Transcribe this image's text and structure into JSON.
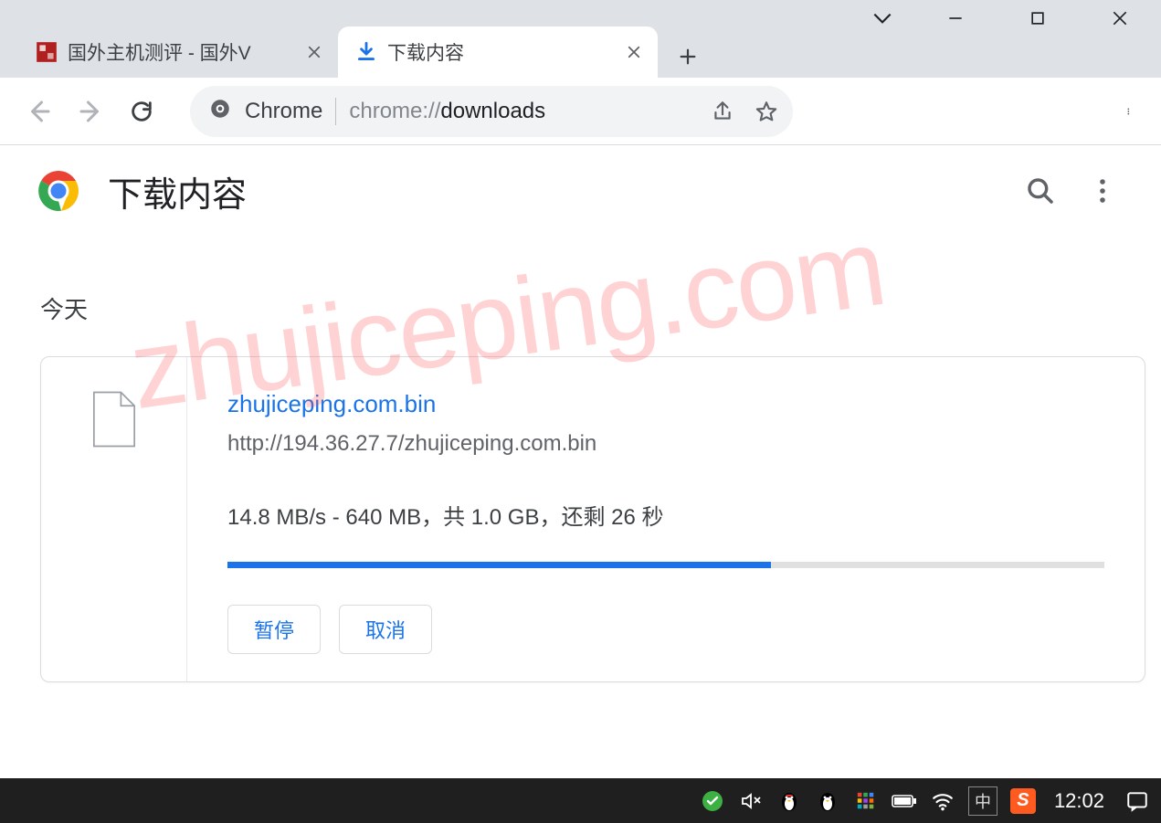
{
  "watermark_text": "zhujiceping.com",
  "tabs": {
    "inactive_title": "国外主机测评 - 国外V",
    "active_title": "下载内容"
  },
  "omnibox": {
    "chip": "Chrome",
    "url_gray_prefix": "chrome://",
    "url_highlight": "downloads"
  },
  "downloads": {
    "page_title": "下载内容",
    "section_label": "今天",
    "item": {
      "file_name": "zhujiceping.com.bin",
      "file_url": "http://194.36.27.7/zhujiceping.com.bin",
      "status": "14.8 MB/s - 640 MB，共 1.0 GB，还剩 26 秒",
      "progress_percent": 62,
      "pause_label": "暂停",
      "cancel_label": "取消"
    }
  },
  "taskbar": {
    "ime_label": "中",
    "sogou_label": "S",
    "time": "12:02"
  }
}
